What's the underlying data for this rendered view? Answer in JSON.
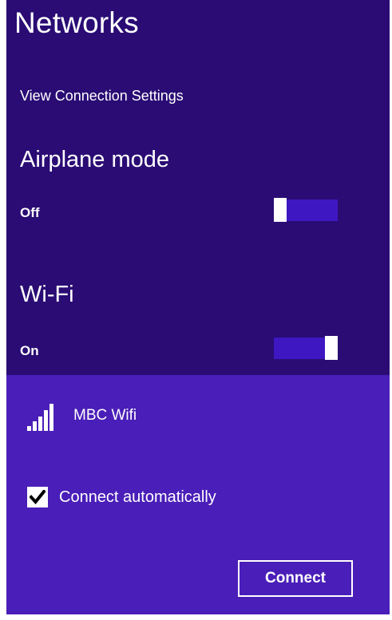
{
  "header": {
    "title": "Networks"
  },
  "settings_link": "View Connection Settings",
  "airplane_mode": {
    "label": "Airplane mode",
    "state": "Off",
    "on": false
  },
  "wifi": {
    "label": "Wi-Fi",
    "state": "On",
    "on": true
  },
  "network": {
    "name": "MBC Wifi",
    "signal_icon": "signal-strength-icon",
    "connect_automatically_label": "Connect automatically",
    "connect_automatically_checked": true,
    "connect_button": "Connect"
  },
  "colors": {
    "panel_dark": "#2a0c74",
    "panel_light": "#4a1eb8",
    "toggle_track": "#3f17c2",
    "foreground": "#ffffff"
  }
}
